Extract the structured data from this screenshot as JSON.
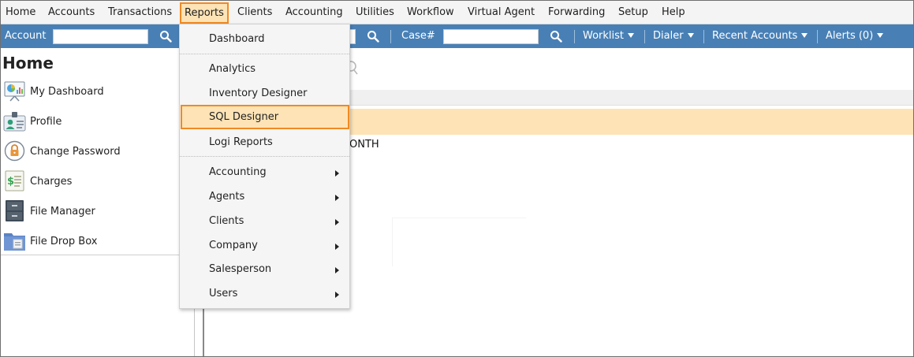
{
  "menubar": {
    "items": [
      "Home",
      "Accounts",
      "Transactions",
      "Reports",
      "Clients",
      "Accounting",
      "Utilities",
      "Workflow",
      "Virtual Agent",
      "Forwarding",
      "Setup",
      "Help"
    ],
    "active_item": "Reports"
  },
  "searchbar": {
    "account_label": "Account",
    "account_value": "",
    "case_label": "Case#",
    "case_value": "",
    "worklist_label": "Worklist",
    "dialer_label": "Dialer",
    "recent_accounts_label": "Recent Accounts",
    "alerts_label": "Alerts (0)",
    "search_icon": "search-icon"
  },
  "leftpanel": {
    "title": "Home",
    "items": [
      {
        "label": "My Dashboard",
        "icon": "dashboard-icon"
      },
      {
        "label": "Profile",
        "icon": "profile-icon"
      },
      {
        "label": "Change Password",
        "icon": "lock-icon"
      },
      {
        "label": "Charges",
        "icon": "charges-icon"
      },
      {
        "label": "File Manager",
        "icon": "file-cabinet-icon"
      },
      {
        "label": "File Drop Box",
        "icon": "folder-icon"
      }
    ]
  },
  "main": {
    "partial_text": "ONTH"
  },
  "reports_menu": {
    "items": [
      {
        "label": "Dashboard",
        "submenu": false
      },
      {
        "label": "Analytics",
        "submenu": false
      },
      {
        "label": "Inventory Designer",
        "submenu": false
      },
      {
        "label": "SQL Designer",
        "submenu": false,
        "highlighted": true
      },
      {
        "label": "Logi Reports",
        "submenu": false
      },
      {
        "label": "Accounting",
        "submenu": true
      },
      {
        "label": "Agents",
        "submenu": true
      },
      {
        "label": "Clients",
        "submenu": true
      },
      {
        "label": "Company",
        "submenu": true
      },
      {
        "label": "Salesperson",
        "submenu": true
      },
      {
        "label": "Users",
        "submenu": true
      }
    ]
  },
  "colors": {
    "bluebar": "#4880b6",
    "highlight_fill": "#fde3b5",
    "highlight_border": "#f08a24"
  }
}
